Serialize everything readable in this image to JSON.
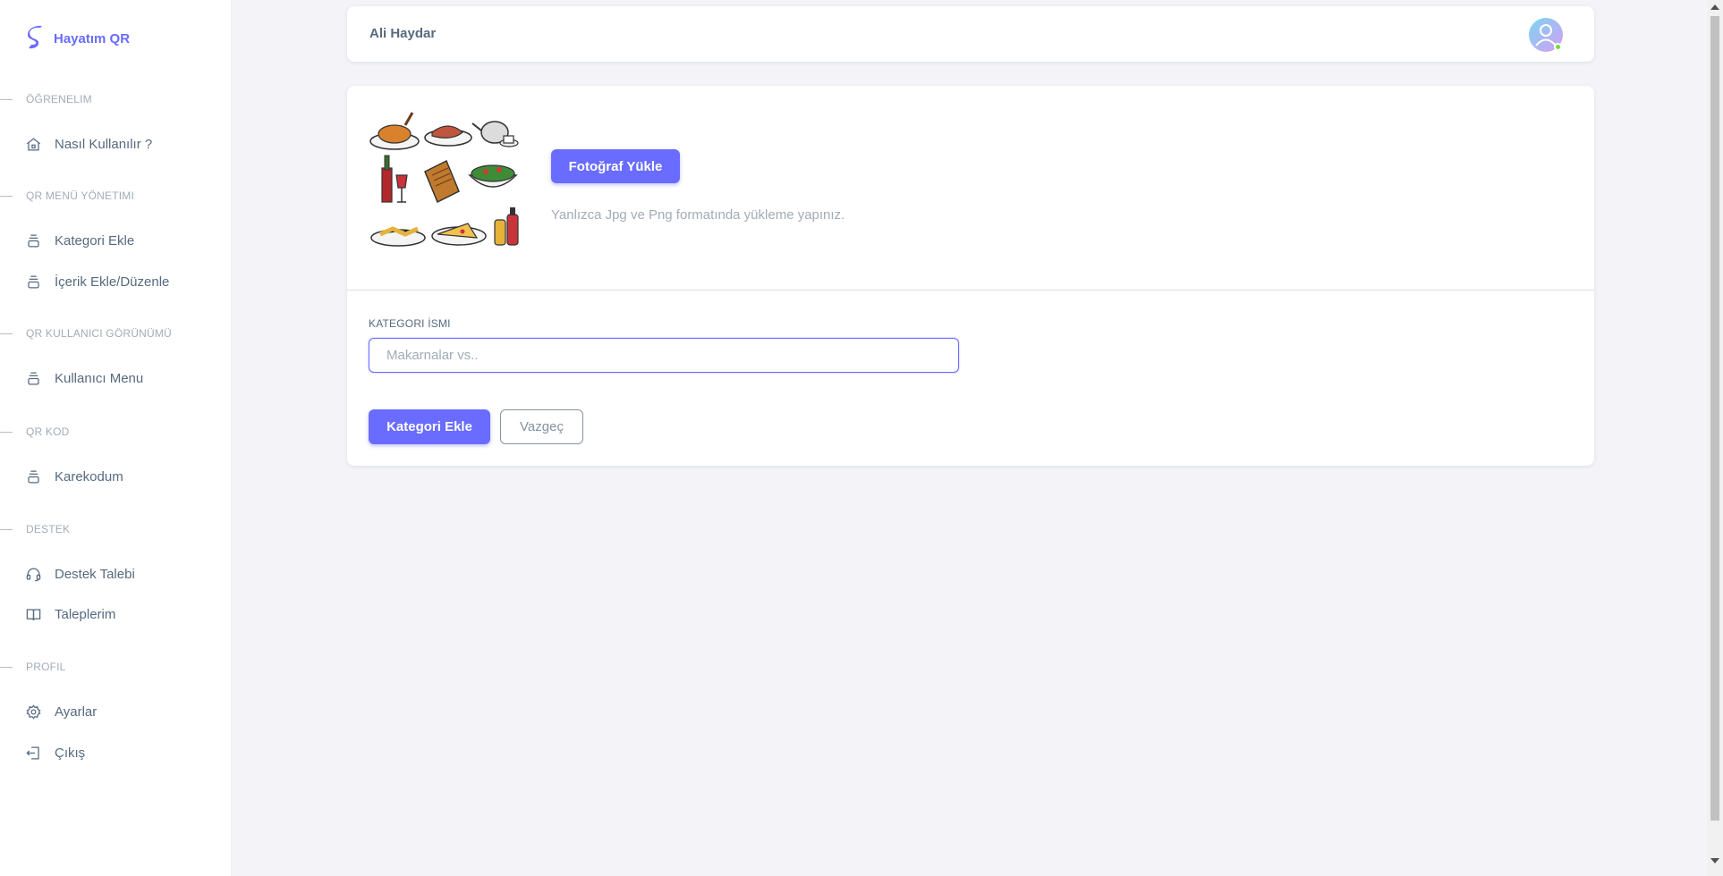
{
  "brand": {
    "name": "Hayatım QR",
    "icon": "brand-s-logo-icon",
    "accent": "#696cff"
  },
  "sidebar": {
    "sections": [
      {
        "title": "ÖĞRENELIM",
        "items": [
          {
            "label": "Nasıl Kullanılır ?",
            "icon": "home-icon"
          }
        ]
      },
      {
        "title": "QR MENÜ YÖNETIMI",
        "items": [
          {
            "label": "Kategori Ekle",
            "icon": "layers-icon"
          },
          {
            "label": "İçerik Ekle/Düzenle",
            "icon": "layers-icon"
          }
        ]
      },
      {
        "title": "QR KULLANICI GÖRÜNÜMÜ",
        "items": [
          {
            "label": "Kullanıcı Menu",
            "icon": "layers-icon"
          }
        ]
      },
      {
        "title": "QR KOD",
        "items": [
          {
            "label": "Karekodum",
            "icon": "layers-icon"
          }
        ]
      },
      {
        "title": "DESTEK",
        "items": [
          {
            "label": "Destek Talebi",
            "icon": "headset-icon"
          },
          {
            "label": "Taleplerim",
            "icon": "book-icon"
          }
        ]
      },
      {
        "title": "PROFIL",
        "items": [
          {
            "label": "Ayarlar",
            "icon": "gear-icon"
          },
          {
            "label": "Çıkış",
            "icon": "logout-icon"
          }
        ]
      }
    ]
  },
  "navbar": {
    "user_name": "Ali Haydar",
    "avatar_icon": "user-avatar-icon",
    "status_color": "#71dd37"
  },
  "upload": {
    "button_label": "Fotoğraf Yükle",
    "hint": "Yanlızca Jpg ve Png formatında yükleme yapınız.",
    "image_icon": "food-collage-image"
  },
  "form": {
    "label": "KATEGORI İSMI",
    "value": "",
    "placeholder": "Makarnalar vs..",
    "submit_label": "Kategori Ekle",
    "cancel_label": "Vazgeç"
  }
}
